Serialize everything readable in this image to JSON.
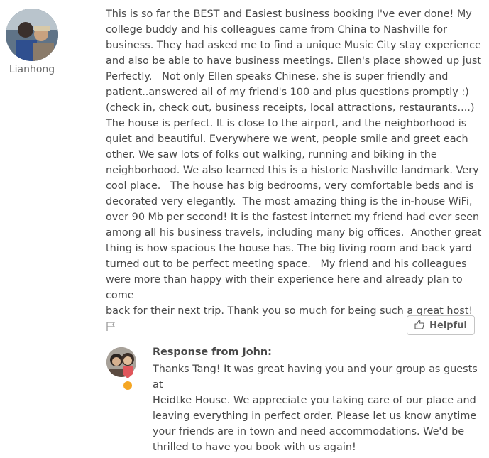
{
  "review": {
    "author": "Lianhong",
    "text": "This is so far the BEST and Easiest business booking I've ever done! My\ncollege buddy and his colleagues came from China to Nashville for\nbusiness. They had asked me to find a unique Music City stay experience\nand also be able to have business meetings. Ellen's place showed up just\nPerfectly.   Not only Ellen speaks Chinese, she is super friendly and\npatient..answered all of my friend's 100 and plus questions promptly :)\n(check in, check out, business receipts, local attractions, restaurants....)\nThe house is perfect. It is close to the airport, and the neighborhood is\nquiet and beautiful. Everywhere we went, people smile and greet each\nother. We saw lots of folks out walking, running and biking in the\nneighborhood. We also learned this is a historic Nashville landmark. Very\ncool place.   The house has big bedrooms, very comfortable beds and is\ndecorated very elegantly.  The most amazing thing is the in-house WiFi,\nover 90 Mb per second! It is the fastest internet my friend had ever seen\namong all his business travels, including many big offices.  Another great\nthing is how spacious the house has. The big living room and back yard\nturned out to be perfect meeting space.   My friend and his colleagues\nwere more than happy with their experience here and already plan to come\nback for their next trip. Thank you so much for being such a great host!"
  },
  "actions": {
    "helpful_label": "Helpful",
    "flag_icon": "flag-icon",
    "helpful_icon": "thumbs-up-icon"
  },
  "response": {
    "title": "Response from John:",
    "text": "Thanks Tang! It was great having you and your group as guests at\nHeidtke House. We appreciate you taking care of our place and\nleaving everything in perfect order. Please let us know anytime\nyour friends are in town and need accommodations. We'd be\nthrilled to have you book with us again!"
  },
  "colors": {
    "text": "#484848",
    "muted": "#6b6b6b",
    "button_border": "#c4c4c4",
    "badge_red": "#e0565b",
    "badge_orange": "#f5a623"
  }
}
